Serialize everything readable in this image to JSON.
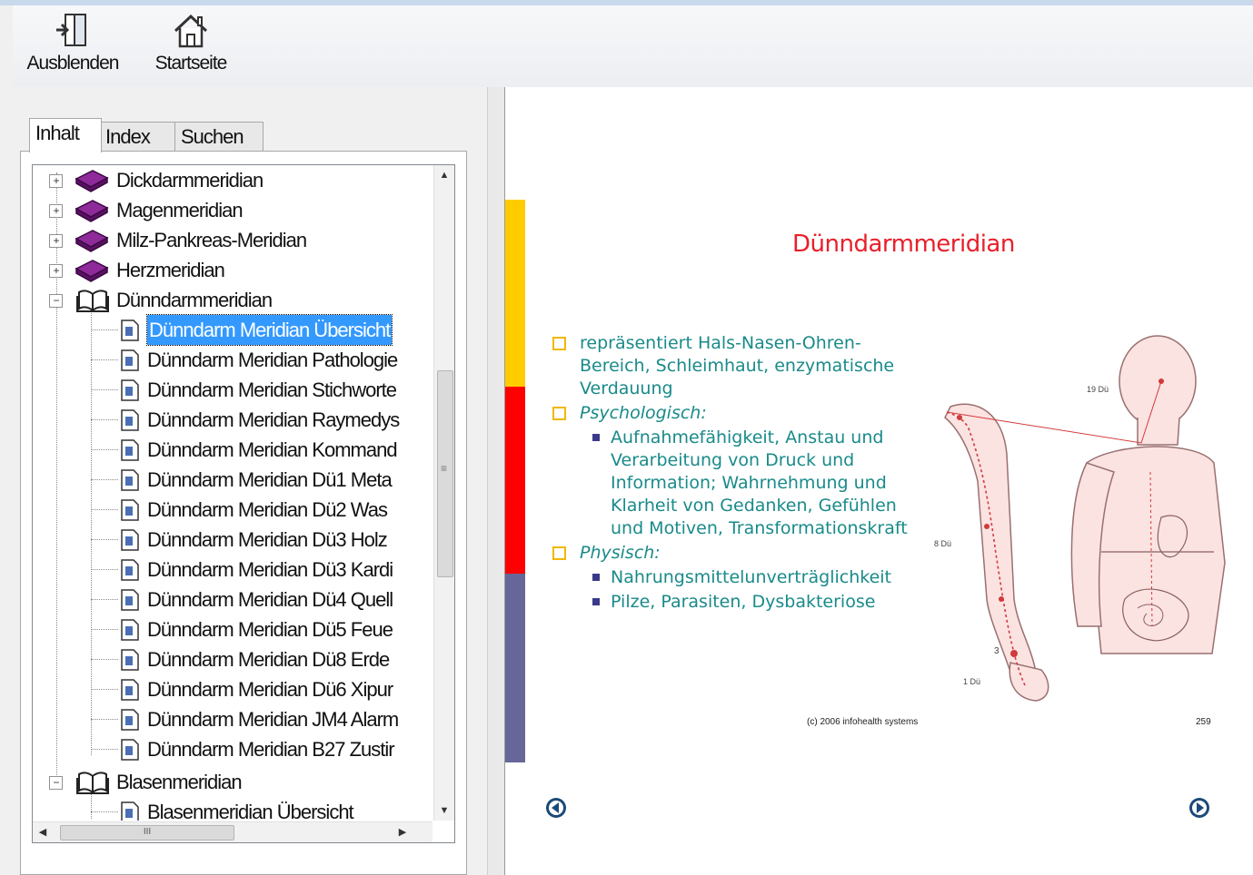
{
  "toolbar": {
    "hide_label": "Ausblenden",
    "home_label": "Startseite"
  },
  "tabs": [
    {
      "label": "Inhalt",
      "active": true
    },
    {
      "label": "Index",
      "active": false
    },
    {
      "label": "Suchen",
      "active": false
    }
  ],
  "tree": {
    "books": [
      {
        "label": "Dickdarmmeridian",
        "state": "collapsed"
      },
      {
        "label": "Magenmeridian",
        "state": "collapsed"
      },
      {
        "label": "Milz-Pankreas-Meridian",
        "state": "collapsed"
      },
      {
        "label": "Herzmeridian",
        "state": "collapsed"
      },
      {
        "label": "Dünndarmmeridian",
        "state": "expanded"
      }
    ],
    "pages": [
      {
        "label": "Dünndarm Meridian Übersicht",
        "selected": true
      },
      {
        "label": "Dünndarm Meridian Pathologie",
        "selected": false
      },
      {
        "label": "Dünndarm Meridian Stichworte",
        "selected": false
      },
      {
        "label": "Dünndarm Meridian Raymedys",
        "selected": false
      },
      {
        "label": "Dünndarm Meridian Kommand",
        "selected": false
      },
      {
        "label": "Dünndarm Meridian Dü1 Meta",
        "selected": false
      },
      {
        "label": "Dünndarm Meridian Dü2 Was",
        "selected": false
      },
      {
        "label": "Dünndarm Meridian Dü3 Holz",
        "selected": false
      },
      {
        "label": "Dünndarm Meridian Dü3 Kardi",
        "selected": false
      },
      {
        "label": "Dünndarm Meridian Dü4 Quell",
        "selected": false
      },
      {
        "label": "Dünndarm Meridian Dü5 Feue",
        "selected": false
      },
      {
        "label": "Dünndarm Meridian Dü8 Erde",
        "selected": false
      },
      {
        "label": "Dünndarm Meridian Dü6 Xipur",
        "selected": false
      },
      {
        "label": "Dünndarm Meridian JM4 Alarm",
        "selected": false
      },
      {
        "label": "Dünndarm Meridian B27 Zustir",
        "selected": false
      }
    ],
    "book2": {
      "label": "Blasenmeridian",
      "state": "expanded"
    },
    "book2_pages": [
      {
        "label": "Blasenmeridian Übersicht"
      }
    ],
    "hscroll_mark": "III",
    "vscroll_mark": "≡"
  },
  "slide": {
    "title": "Dünndarmmeridian",
    "bullet1": "repräsentiert Hals-Nasen-Ohren-Bereich, Schleimhaut, enzymatische Verdauung",
    "bullet2": "Psychologisch:",
    "bullet2_sub": "Aufnahmefähigkeit, Anstau und Verarbeitung von Druck und Information; Wahrnehmung und Klarheit von Gedanken, Gefühlen und Motiven, Transformationskraft",
    "bullet3": "Physisch:",
    "bullet3_sub1": "Nahrungsmittelunverträglichkeit",
    "bullet3_sub2": "Pilze, Parasiten, Dysbakteriose",
    "copyright": "(c) 2006 infohealth systems",
    "page": "259",
    "figure_labels": [
      "19 Dü",
      "8 Dü",
      "3",
      "1 Dü"
    ],
    "bar_colors": [
      "#ffcc00",
      "#ff0000",
      "#666699"
    ]
  }
}
